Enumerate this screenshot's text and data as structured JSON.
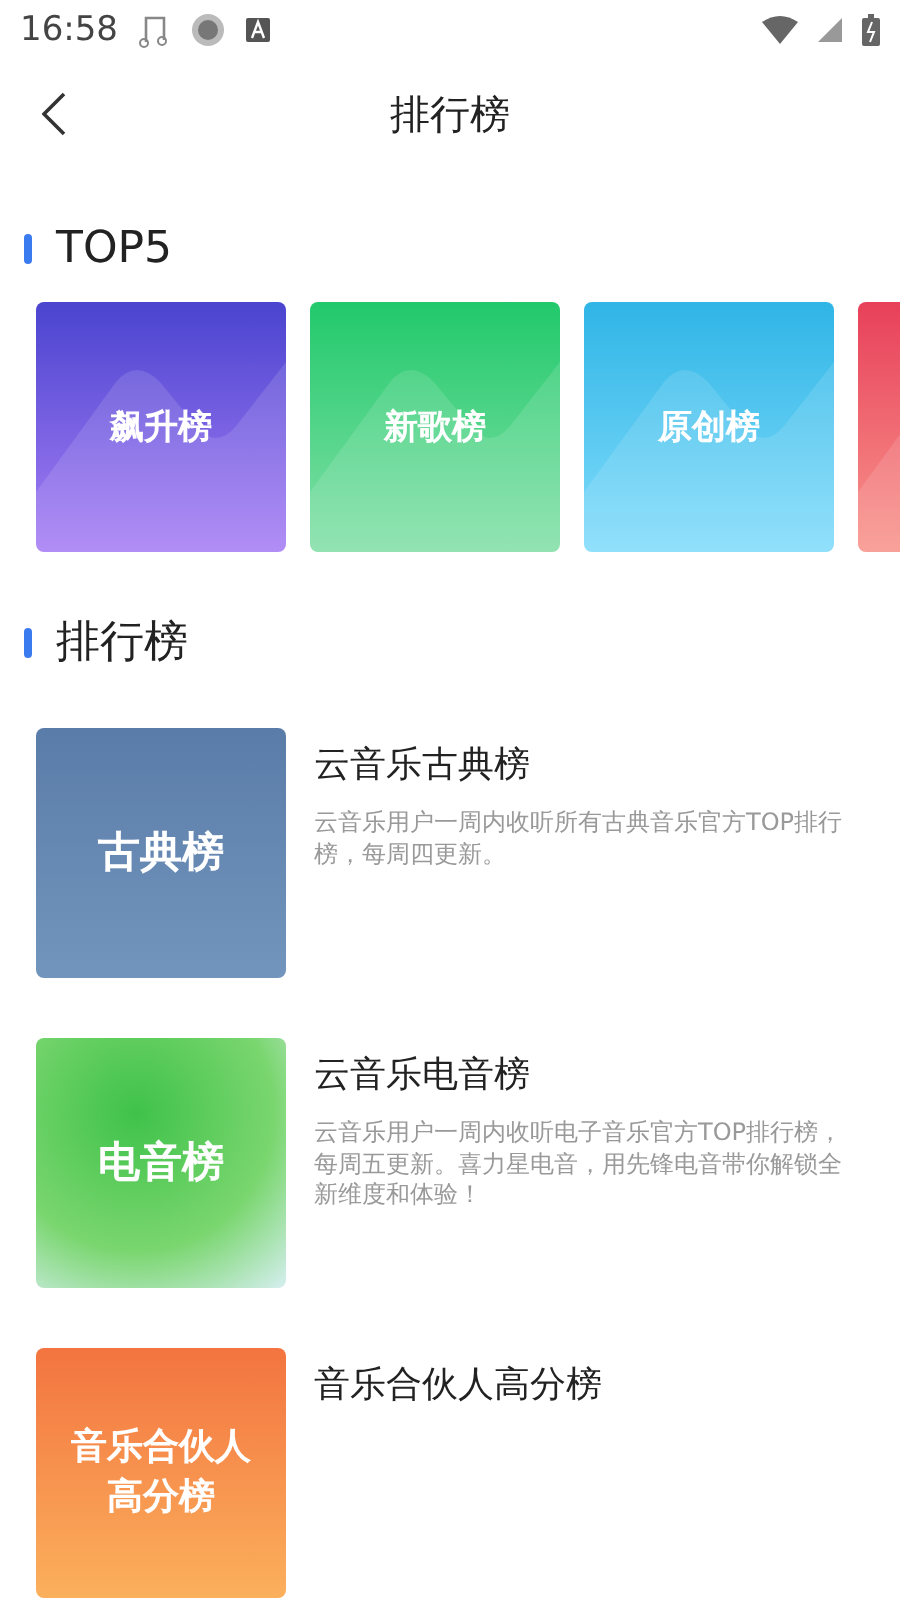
{
  "status_bar": {
    "time": "16:58"
  },
  "header": {
    "title": "排行榜"
  },
  "top_section": {
    "title": "TOP5",
    "cards": [
      {
        "label": "飙升榜",
        "kind": "purple"
      },
      {
        "label": "新歌榜",
        "kind": "green"
      },
      {
        "label": "原创榜",
        "kind": "blue"
      },
      {
        "kind": "red"
      }
    ]
  },
  "list_section": {
    "title": "排行榜",
    "items": [
      {
        "cover_label": "古典榜",
        "kind": "slate",
        "title": "云音乐古典榜",
        "description": "云音乐用户一周内收听所有古典音乐官方TOP排行榜，每周四更新。"
      },
      {
        "cover_label": "电音榜",
        "kind": "lime",
        "title": "云音乐电音榜",
        "description": "云音乐用户一周内收听电子音乐官方TOP排行榜，每周五更新。喜力星电音，用先锋电音带你解锁全新维度和体验！"
      },
      {
        "cover_label": "音乐合伙人高分榜",
        "kind": "orange",
        "title": "音乐合伙人高分榜"
      }
    ]
  }
}
